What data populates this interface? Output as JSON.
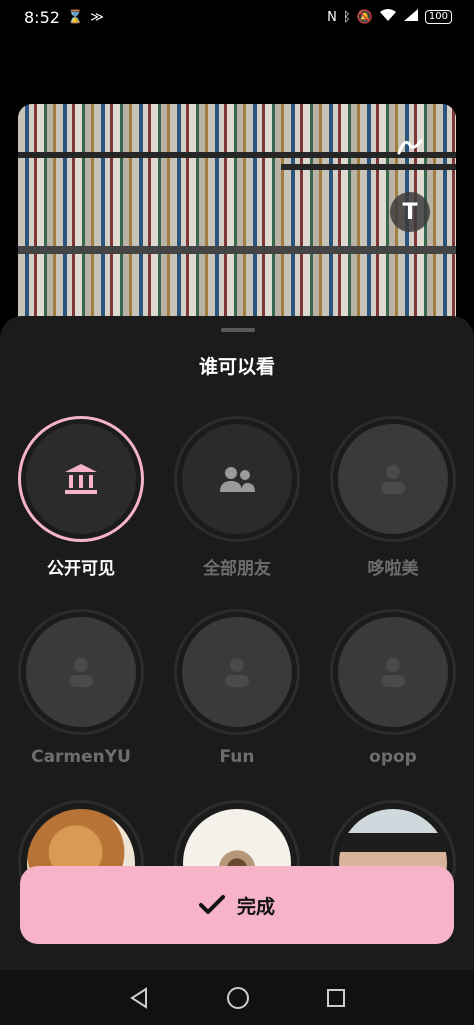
{
  "status_bar": {
    "time": "8:52",
    "battery": "100"
  },
  "photo": {
    "tools": [
      "draw-icon",
      "text-icon"
    ],
    "text_tool_label": "T"
  },
  "sheet": {
    "title": "谁可以看",
    "options": [
      {
        "label": "公开可见",
        "icon": "museum-icon",
        "selected": true
      },
      {
        "label": "全部朋友",
        "icon": "group-icon",
        "selected": false
      },
      {
        "label": "哆啦美",
        "icon": "person-icon",
        "selected": false
      },
      {
        "label": "CarmenYU",
        "icon": "person-icon",
        "selected": false
      },
      {
        "label": "Fun",
        "icon": "person-icon",
        "selected": false
      },
      {
        "label": "opop",
        "icon": "person-icon",
        "selected": false
      }
    ],
    "photo_avatars": [
      "cat-avatar",
      "sketch-avatar",
      "face-avatar"
    ],
    "done_label": "完成"
  },
  "colors": {
    "accent": "#f7b3c8",
    "sheet_bg": "#1b1b1b"
  }
}
